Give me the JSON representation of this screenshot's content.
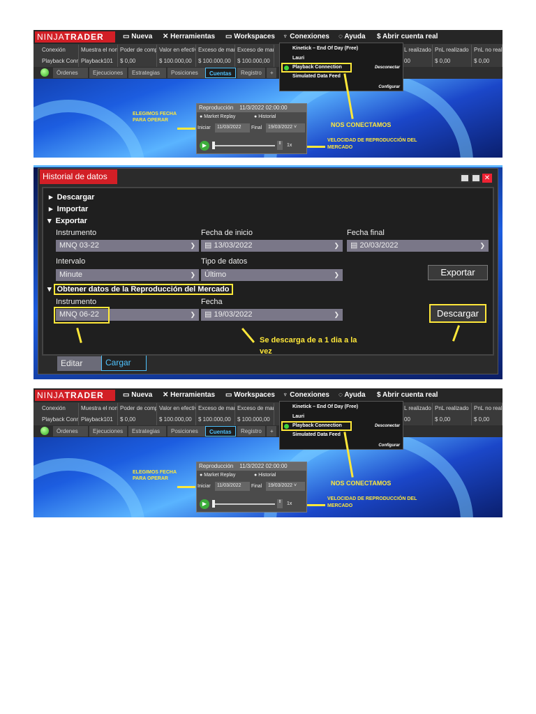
{
  "screens": [
    {
      "logo": {
        "left": "NINJA",
        "right": "TRADER"
      },
      "menu": [
        "Nueva",
        "Herramientas",
        "Workspaces",
        "Conexiones",
        "Ayuda",
        "Abrir cuenta real"
      ],
      "columns": [
        "Conexión",
        "Muestra el non",
        "Poder de comp",
        "Valor en efectiv",
        "Exceso de mar",
        "Exceso de mar",
        "L realizado I",
        "PnL realizado",
        "PnL no real"
      ],
      "row": [
        "Playback Conn",
        "Playback101",
        "$ 0,00",
        "$ 100.000,00",
        "$ 100.000,00",
        "$ 100.000,00",
        "00",
        "$ 0,00",
        "$ 0,00"
      ],
      "tabs": [
        "Órdenes",
        "Ejecuciones",
        "Estrategias",
        "Posiciones",
        "Cuentas",
        "Registro",
        "+"
      ],
      "connections": {
        "items": [
          "Kinetick – End Of Day (Free)",
          "Lauri",
          "Playback Connection",
          "Simulated Data Feed"
        ],
        "disconnect": "Desconectar",
        "configure": "Configurar"
      },
      "replay": {
        "title": "Reproducción",
        "time": "11/3/2022 02:00:00",
        "opt1": "Market Replay",
        "opt2": "Historial",
        "start_label": "Iniciar",
        "start": "11/03/2022",
        "end_label": "Final",
        "end": "19/03/2022",
        "speed": "1x"
      },
      "notes": {
        "date": "ELEGIMOS FECHA PARA OPERAR",
        "connect": "NOS CONECTAMOS",
        "speed": "VELOCIDAD DE REPRODUCCIÓN DEL MERCADO"
      }
    },
    {
      "logo": {
        "left": "NINJA",
        "right": "TRADER"
      },
      "menu": [
        "Nueva",
        "Herramientas",
        "Workspaces",
        "Conexiones",
        "Ayuda",
        "Abrir cuenta real"
      ],
      "columns": [
        "Conexión",
        "Muestra el non",
        "Poder de comp",
        "Valor en efectiv",
        "Exceso de mar",
        "Exceso de mar",
        "L realizado I",
        "PnL realizado",
        "PnL no real"
      ],
      "row": [
        "Playback Conn",
        "Playback101",
        "$ 0,00",
        "$ 100.000,00",
        "$ 100.000,00",
        "$ 100.000,00",
        "00",
        "$ 0,00",
        "$ 0,00"
      ],
      "tabs": [
        "Órdenes",
        "Ejecuciones",
        "Estrategias",
        "Posiciones",
        "Cuentas",
        "Registro",
        "+"
      ],
      "connections": {
        "items": [
          "Kinetick – End Of Day (Free)",
          "Lauri",
          "Playback Connection",
          "Simulated Data Feed"
        ],
        "disconnect": "Desconectar",
        "configure": "Configurar"
      },
      "replay": {
        "title": "Reproducción",
        "time": "11/3/2022 02:00:00",
        "opt1": "Market Replay",
        "opt2": "Historial",
        "start_label": "Iniciar",
        "start": "11/03/2022",
        "end_label": "Final",
        "end": "19/03/2022",
        "speed": "1x"
      },
      "notes": {
        "date": "ELEGIMOS FECHA PARA OPERAR",
        "connect": "NOS CONECTAMOS",
        "speed": "VELOCIDAD DE REPRODUCCIÓN DEL MERCADO"
      }
    }
  ],
  "history": {
    "title": "Historial de datos",
    "sections": [
      "Descargar",
      "Importar",
      "Exportar"
    ],
    "export": {
      "instrument_label": "Instrumento",
      "instrument": "MNQ 03-22",
      "start_label": "Fecha de inicio",
      "start": "13/03/2022",
      "end_label": "Fecha final",
      "end": "20/03/2022",
      "interval_label": "Intervalo",
      "interval": "Minute",
      "type_label": "Tipo de datos",
      "type": "Último",
      "button": "Exportar"
    },
    "replay": {
      "section": "Obtener datos de la Reproducción del Mercado",
      "instrument_label": "Instrumento",
      "instrument": "MNQ 06-22",
      "date_label": "Fecha",
      "date": "19/03/2022",
      "button": "Descargar"
    },
    "note": "Se descarga de a 1 dia a la vez",
    "tabs": [
      "Editar",
      "Cargar"
    ]
  }
}
